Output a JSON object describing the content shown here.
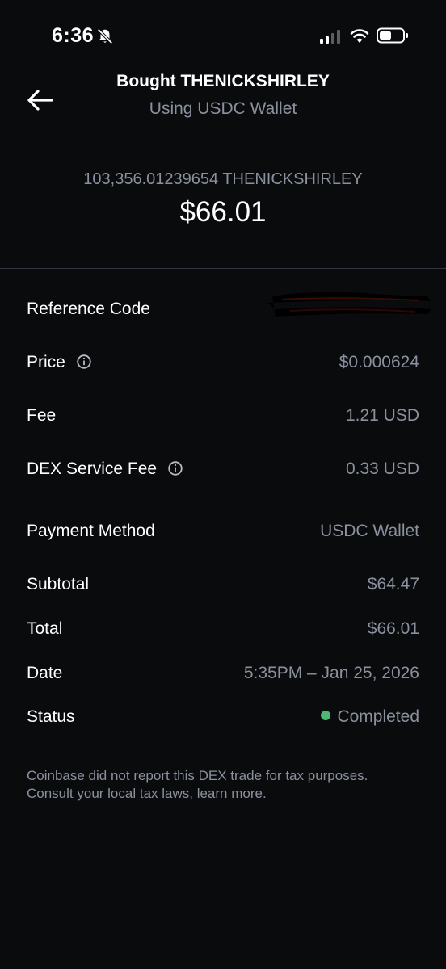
{
  "status_bar": {
    "time": "6:36",
    "icons": [
      "bell-slash-icon",
      "signal-icon",
      "wifi-icon",
      "battery-icon"
    ]
  },
  "header": {
    "back_icon": "arrow-left-icon",
    "title": "Bought THENICKSHIRLEY",
    "subtitle": "Using USDC Wallet"
  },
  "summary": {
    "crypto_amount": "103,356.01239654 THENICKSHIRLEY",
    "fiat_amount": "$66.01"
  },
  "details": {
    "reference_code": {
      "label": "Reference Code"
    },
    "price": {
      "label": "Price",
      "value": "$0.000624"
    },
    "fee": {
      "label": "Fee",
      "value": "1.21 USD"
    },
    "dex_fee": {
      "label": "DEX Service Fee",
      "value": "0.33 USD"
    },
    "payment_method": {
      "label": "Payment Method",
      "value": "USDC Wallet"
    },
    "subtotal": {
      "label": "Subtotal",
      "value": "$64.47"
    },
    "total": {
      "label": "Total",
      "value": "$66.01"
    },
    "date": {
      "label": "Date",
      "value": "5:35PM – Jan 25, 2026"
    },
    "status": {
      "label": "Status",
      "value": "Completed"
    }
  },
  "note": {
    "text": "Coinbase did not report this DEX trade for tax purposes. Consult your local tax laws, ",
    "link": "learn more",
    "end": "."
  },
  "colors": {
    "background": "#0a0b0d",
    "muted_text": "#8a919e",
    "status_green": "#4fb875"
  }
}
